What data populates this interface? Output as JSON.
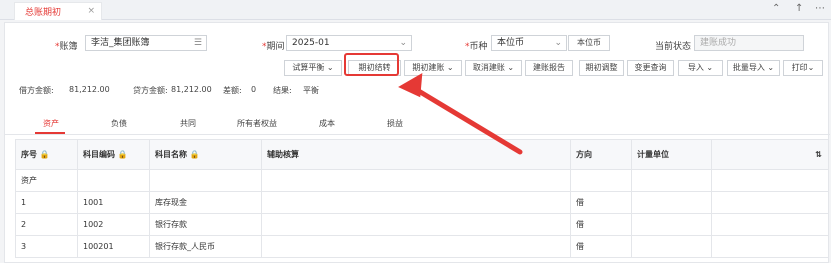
{
  "tabbar": {
    "active_tab": "总账期初",
    "close": "×",
    "restore": "⌃",
    "up": "↑",
    "more": "⋯"
  },
  "form": {
    "ledger_label": "账簿",
    "ledger_value": "李洁_集团账簿",
    "period_label": "期间",
    "period_value": "2025-01",
    "currency_label": "币种",
    "currency_value": "本位币",
    "currency_btn": "本位币",
    "status_label": "当前状态",
    "status_value": "建账成功"
  },
  "toolbar": {
    "trial_balance": "试算平衡",
    "period_close": "期初结转",
    "period_build": "期初建账",
    "cancel_build": "取消建账",
    "build_report": "建账报告",
    "period_adjust": "期初调整",
    "change_query": "变更查询",
    "import": "导入",
    "batch_import": "批量导入",
    "print": "打印"
  },
  "stats": {
    "debit_label": "借方金额:",
    "debit_value": "81,212.00",
    "credit_label": "贷方金额:",
    "credit_value": "81,212.00",
    "diff_label": "差额:",
    "diff_value": "0",
    "result_label": "结果:",
    "result_value": "平衡"
  },
  "account_tabs": [
    "资产",
    "负债",
    "共同",
    "所有者权益",
    "成本",
    "损益"
  ],
  "table": {
    "headers": [
      "序号",
      "科目编码",
      "科目名称",
      "辅助核算",
      "方向",
      "计量单位"
    ],
    "rows": [
      [
        "资产",
        "",
        "",
        "",
        "",
        ""
      ],
      [
        "1",
        "1001",
        "库存现金",
        "",
        "借",
        ""
      ],
      [
        "2",
        "1002",
        "银行存款",
        "",
        "借",
        ""
      ],
      [
        "3",
        "100201",
        "银行存款_人民币",
        "",
        "借",
        ""
      ]
    ]
  },
  "colors": {
    "accent": "#e53935",
    "lock_icon": "#6b8fd6"
  }
}
